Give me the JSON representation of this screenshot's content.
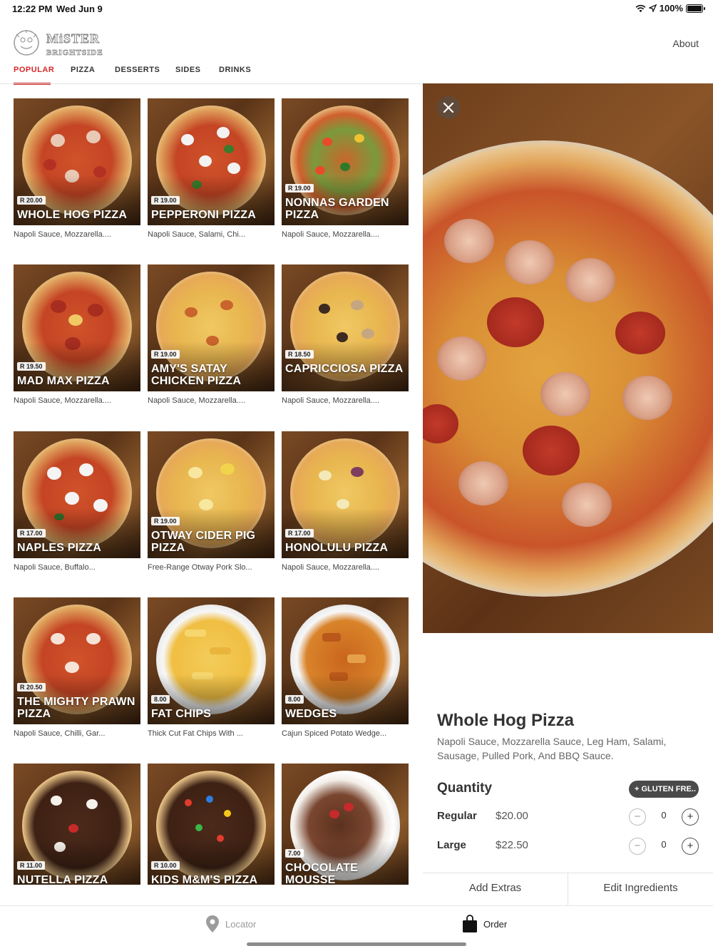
{
  "status_bar": {
    "time": "12:22 PM",
    "date": "Wed Jun 9",
    "battery": "100%"
  },
  "header": {
    "brand_line1": "MiSTER",
    "brand_line2": "BRIGHTSIDE",
    "about_label": "About"
  },
  "categories": [
    "POPULAR",
    "PIZZA",
    "DESSERTS",
    "SIDES",
    "DRINKS"
  ],
  "active_category": "POPULAR",
  "menu_items": [
    {
      "title": "WHOLE HOG PIZZA",
      "price": "R 20.00",
      "desc": "Napoli Sauce, Mozzarella...."
    },
    {
      "title": "PEPPERONI PIZZA",
      "price": "R 19.00",
      "desc": "Napoli Sauce, Salami, Chi..."
    },
    {
      "title": "NONNAS GARDEN PIZZA",
      "price": "R 19.00",
      "desc": "Napoli Sauce, Mozzarella...."
    },
    {
      "title": "MAD MAX PIZZA",
      "price": "R 19.50",
      "desc": "Napoli Sauce, Mozzarella...."
    },
    {
      "title": "AMY'S SATAY CHICKEN PIZZA",
      "price": "R 19.00",
      "desc": "Napoli Sauce, Mozzarella...."
    },
    {
      "title": "CAPRICCIOSA PIZZA",
      "price": "R 18.50",
      "desc": "Napoli Sauce, Mozzarella...."
    },
    {
      "title": "NAPLES PIZZA",
      "price": "R 17.00",
      "desc": "Napoli Sauce, Buffalo..."
    },
    {
      "title": "OTWAY CIDER PIG PIZZA",
      "price": "R 19.00",
      "desc": "Free-Range Otway Pork Slo..."
    },
    {
      "title": "HONOLULU PIZZA",
      "price": "R 17.00",
      "desc": "Napoli Sauce, Mozzarella...."
    },
    {
      "title": "THE MIGHTY PRAWN PIZZA",
      "price": "R 20.50",
      "desc": "Napoli Sauce, Chilli, Gar..."
    },
    {
      "title": "FAT CHIPS",
      "price": "8.00",
      "desc": "Thick Cut Fat Chips With ..."
    },
    {
      "title": "WEDGES",
      "price": "8.00",
      "desc": "Cajun Spiced Potato Wedge..."
    },
    {
      "title": "NUTELLA PIZZA",
      "price": "R 11.00",
      "desc": ""
    },
    {
      "title": "KIDS M&M'S PIZZA",
      "price": "R 10.00",
      "desc": ""
    },
    {
      "title": "CHOCOLATE MOUSSE",
      "price": "7.00",
      "desc": ""
    }
  ],
  "detail": {
    "title": "Whole Hog Pizza",
    "description": "Napoli Sauce, Mozzarella Sauce, Leg Ham, Salami, Sausage, Pulled Pork, And BBQ Sauce.",
    "quantity_label": "Quantity",
    "gluten_free_label": "GLUTEN FRE..",
    "sizes": [
      {
        "name": "Regular",
        "price": "$20.00",
        "qty": "0"
      },
      {
        "name": "Large",
        "price": "$22.50",
        "qty": "0"
      }
    ],
    "add_extras_label": "Add Extras",
    "edit_ingredients_label": "Edit Ingredients"
  },
  "tab_bar": {
    "locator_label": "Locator",
    "order_label": "Order"
  },
  "colors": {
    "accent": "#d62828",
    "badge": "#4a4a4a"
  },
  "icons": [
    "wifi-icon",
    "location-arrow-icon",
    "battery-icon",
    "close-icon",
    "plus-icon",
    "minus-icon",
    "map-pin-icon",
    "shopping-bag-icon"
  ]
}
